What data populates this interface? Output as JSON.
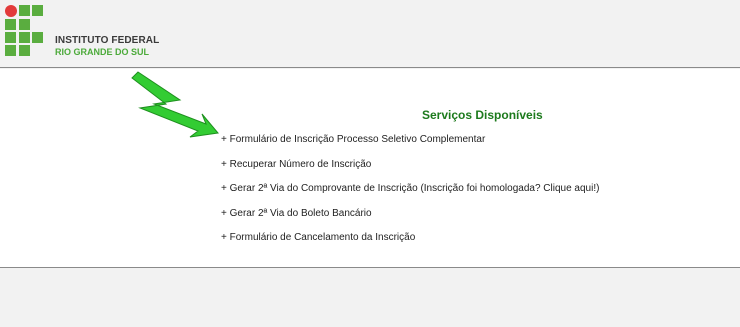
{
  "header": {
    "brand_line1": "INSTITUTO FEDERAL",
    "brand_line2": "RIO GRANDE DO SUL",
    "logo_icon": "if-logo-icon"
  },
  "main": {
    "arrow_icon": "green-zigzag-arrow-icon",
    "title": "Serviços Disponíveis",
    "services": [
      {
        "label": "+ Formulário de Inscrição Processo Seletivo Complementar"
      },
      {
        "label": "+ Recuperar Número de Inscrição"
      },
      {
        "label": "+ Gerar 2ª Via do Comprovante de Inscrição (Inscrição foi homologada? Clique aqui!)"
      },
      {
        "label": "+ Gerar 2ª Via do Boleto Bancário"
      },
      {
        "label": "+ Formulário de Cancelamento da Inscrição"
      }
    ]
  },
  "colors": {
    "accent_green": "#1c7a1c",
    "logo_green": "#5aad3f",
    "logo_red": "#e23a3a",
    "arrow_green": "#33cc33"
  }
}
